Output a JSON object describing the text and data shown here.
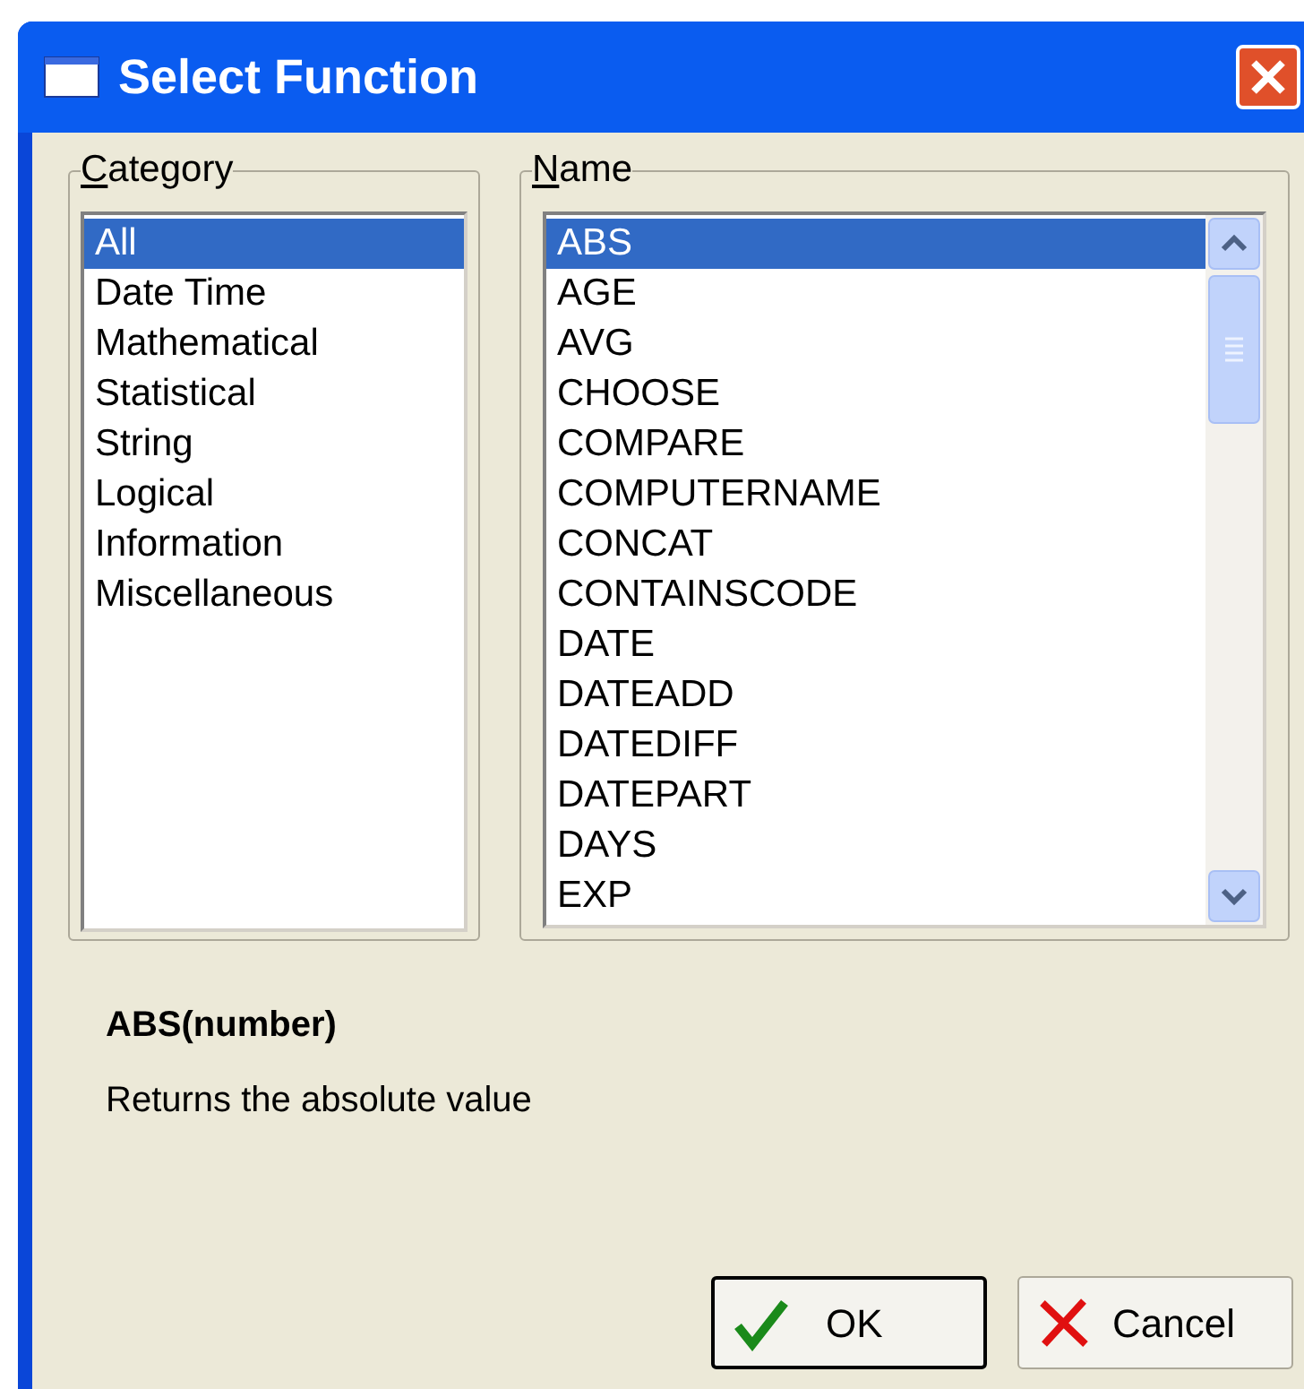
{
  "window": {
    "title": "Select Function"
  },
  "category": {
    "label": "Category",
    "items": [
      {
        "label": "All",
        "selected": true
      },
      {
        "label": "Date Time",
        "selected": false
      },
      {
        "label": "Mathematical",
        "selected": false
      },
      {
        "label": "Statistical",
        "selected": false
      },
      {
        "label": "String",
        "selected": false
      },
      {
        "label": "Logical",
        "selected": false
      },
      {
        "label": "Information",
        "selected": false
      },
      {
        "label": "Miscellaneous",
        "selected": false
      }
    ]
  },
  "name": {
    "label": "Name",
    "items": [
      {
        "label": "ABS",
        "selected": true
      },
      {
        "label": "AGE",
        "selected": false
      },
      {
        "label": "AVG",
        "selected": false
      },
      {
        "label": "CHOOSE",
        "selected": false
      },
      {
        "label": "COMPARE",
        "selected": false
      },
      {
        "label": "COMPUTERNAME",
        "selected": false
      },
      {
        "label": "CONCAT",
        "selected": false
      },
      {
        "label": "CONTAINSCODE",
        "selected": false
      },
      {
        "label": "DATE",
        "selected": false
      },
      {
        "label": "DATEADD",
        "selected": false
      },
      {
        "label": "DATEDIFF",
        "selected": false
      },
      {
        "label": "DATEPART",
        "selected": false
      },
      {
        "label": "DAYS",
        "selected": false
      },
      {
        "label": "EXP",
        "selected": false
      }
    ]
  },
  "signature": "ABS(number)",
  "description": "Returns the absolute value",
  "buttons": [
    {
      "label": "OK",
      "kind": "ok"
    },
    {
      "label": "Cancel",
      "kind": "cancel"
    }
  ]
}
